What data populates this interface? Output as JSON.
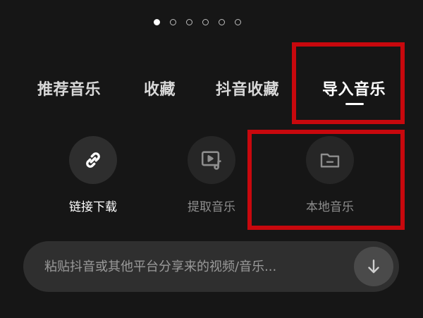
{
  "pager": {
    "count": 6,
    "active_index": 0
  },
  "tabs": [
    {
      "label": "推荐音乐"
    },
    {
      "label": "收藏"
    },
    {
      "label": "抖音收藏"
    },
    {
      "label": "导入音乐"
    }
  ],
  "actions": [
    {
      "label": "链接下载",
      "icon": "link-icon"
    },
    {
      "label": "提取音乐",
      "icon": "video-music-icon"
    },
    {
      "label": "本地音乐",
      "icon": "folder-icon"
    }
  ],
  "search": {
    "placeholder": "粘贴抖音或其他平台分享来的视频/音乐...",
    "button_icon": "download-arrow-icon"
  },
  "colors": {
    "background": "#161616",
    "highlight": "#c8080d",
    "active_text": "#ffffff",
    "inactive_text": "#8e8e8e"
  }
}
